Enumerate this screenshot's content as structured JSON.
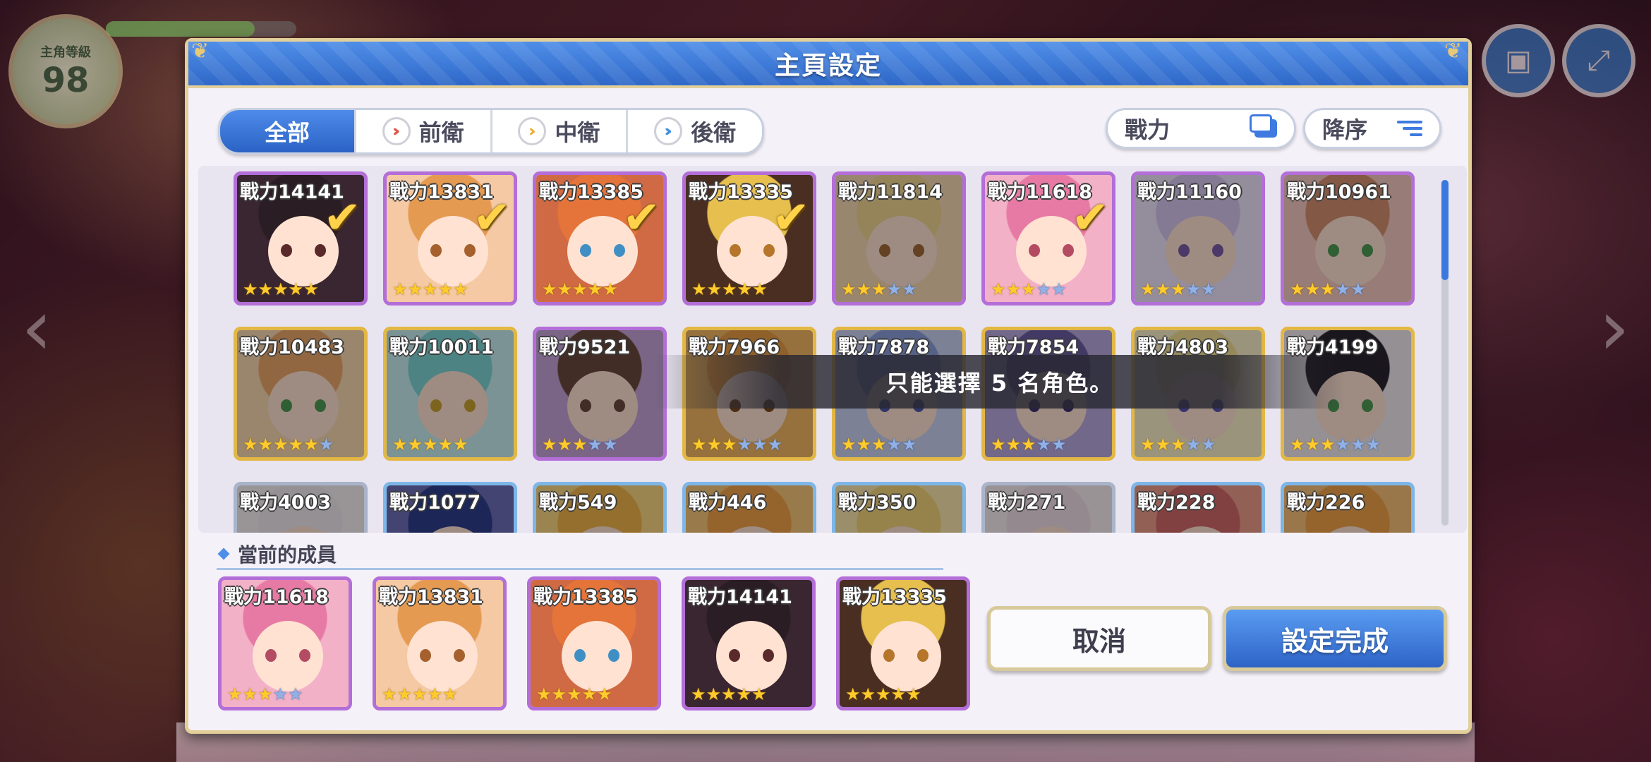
{
  "background": {
    "level_caption": "主角等級",
    "level": "98"
  },
  "dialog": {
    "title": "主頁設定",
    "tabs": [
      {
        "label": "全部",
        "active": true
      },
      {
        "label": "前衛",
        "icon": "vanguard-icon",
        "color": "#e05a4e"
      },
      {
        "label": "中衛",
        "icon": "midguard-icon",
        "color": "#f0a82a"
      },
      {
        "label": "後衛",
        "icon": "rearguard-icon",
        "color": "#3f8fe0"
      }
    ],
    "sort_key": "戰力",
    "sort_order": "降序",
    "characters": [
      {
        "power": "戰力14141",
        "stars": 5,
        "max_stars": 5,
        "selected": true,
        "frame": "purple",
        "hair": "#2b1d24",
        "bg": "#3a2630",
        "eye": "#5a2a2a"
      },
      {
        "power": "戰力13831",
        "stars": 5,
        "max_stars": 5,
        "selected": true,
        "frame": "purple",
        "hair": "#e59a52",
        "bg": "#f4c9a3",
        "eye": "#a5602d"
      },
      {
        "power": "戰力13385",
        "stars": 5,
        "max_stars": 5,
        "selected": true,
        "frame": "purple",
        "hair": "#e4743a",
        "bg": "#d06a44",
        "eye": "#3f8fc4"
      },
      {
        "power": "戰力13335",
        "stars": 5,
        "max_stars": 5,
        "selected": true,
        "frame": "purple",
        "hair": "#e6bf4f",
        "bg": "#4a2e22",
        "eye": "#b5752a"
      },
      {
        "power": "戰力11814",
        "stars": 3,
        "max_stars": 5,
        "selected": false,
        "frame": "purple",
        "hair": "#f1d390",
        "bg": "#f7d9b4",
        "eye": "#a06a38"
      },
      {
        "power": "戰力11618",
        "stars": 3,
        "max_stars": 5,
        "selected": true,
        "frame": "purple",
        "hair": "#e77aa4",
        "bg": "#f3b1c8",
        "eye": "#b34c62"
      },
      {
        "power": "戰力11160",
        "stars": 3,
        "max_stars": 5,
        "selected": false,
        "frame": "purple",
        "hair": "#d6c6ef",
        "bg": "#efe4fb",
        "eye": "#7b5da6"
      },
      {
        "power": "戰力10961",
        "stars": 3,
        "max_stars": 5,
        "selected": false,
        "frame": "purple",
        "hair": "#d48e6e",
        "bg": "#f6c8c0",
        "eye": "#4f9a55"
      },
      {
        "power": "戰力10483",
        "stars": 5,
        "max_stars": 6,
        "selected": false,
        "frame": "gold",
        "hair": "#eba76b",
        "bg": "#f9d9b0",
        "eye": "#4f9a55"
      },
      {
        "power": "戰力10011",
        "stars": 5,
        "max_stars": 5,
        "selected": false,
        "frame": "gold",
        "hair": "#7ed3d6",
        "bg": "#c7eef0",
        "eye": "#c9a233"
      },
      {
        "power": "戰力9521",
        "stars": 3,
        "max_stars": 5,
        "selected": false,
        "frame": "purple",
        "hair": "#6a4a3c",
        "bg": "#c5a3d9",
        "eye": "#6a4a3c"
      },
      {
        "power": "戰力7966",
        "stars": 3,
        "max_stars": 6,
        "selected": false,
        "frame": "gold",
        "hair": "#e89b45",
        "bg": "#f2b763",
        "eye": "#7a4a20"
      },
      {
        "power": "戰力7878",
        "stars": 3,
        "max_stars": 5,
        "selected": false,
        "frame": "gold",
        "hair": "#8b9ddc",
        "bg": "#c8d0f0",
        "eye": "#4c5aa8"
      },
      {
        "power": "戰力7854",
        "stars": 3,
        "max_stars": 5,
        "selected": false,
        "frame": "gold",
        "hair": "#6c5ca3",
        "bg": "#b8a8de",
        "eye": "#3f3170"
      },
      {
        "power": "戰力4803",
        "stars": 3,
        "max_stars": 5,
        "selected": false,
        "frame": "gold",
        "hair": "#f1dd95",
        "bg": "#fbefc9",
        "eye": "#5a53b0"
      },
      {
        "power": "戰力4199",
        "stars": 3,
        "max_stars": 6,
        "selected": false,
        "frame": "gold",
        "hair": "#2a2430",
        "bg": "#efe9ef",
        "eye": "#4f9a55"
      },
      {
        "power": "戰力4003",
        "stars": 0,
        "max_stars": 0,
        "selected": false,
        "frame": "silver",
        "hair": "#f1e8ef",
        "bg": "#f7f0f4",
        "eye": "#b05a7a"
      },
      {
        "power": "戰力1077",
        "stars": 0,
        "max_stars": 0,
        "selected": false,
        "frame": "blue",
        "hair": "#2e3f8e",
        "bg": "#6f6fb8",
        "eye": "#2e3f8e"
      },
      {
        "power": "戰力549",
        "stars": 0,
        "max_stars": 0,
        "selected": false,
        "frame": "blue",
        "hair": "#f1b34a",
        "bg": "#f8d682",
        "eye": "#a06a38"
      },
      {
        "power": "戰力446",
        "stars": 0,
        "max_stars": 0,
        "selected": false,
        "frame": "blue",
        "hair": "#f1a24a",
        "bg": "#f7c77a",
        "eye": "#a06a38"
      },
      {
        "power": "戰力350",
        "stars": 0,
        "max_stars": 0,
        "selected": false,
        "frame": "blue",
        "hair": "#f3d27a",
        "bg": "#fae6ac",
        "eye": "#a06a38"
      },
      {
        "power": "戰力271",
        "stars": 0,
        "max_stars": 0,
        "selected": false,
        "frame": "silver",
        "hair": "#f1dde8",
        "bg": "#f8edf3",
        "eye": "#b05a7a"
      },
      {
        "power": "戰力228",
        "stars": 0,
        "max_stars": 0,
        "selected": false,
        "frame": "blue",
        "hair": "#d26a6a",
        "bg": "#ee9c8c",
        "eye": "#8a3a3a"
      },
      {
        "power": "戰力226",
        "stars": 0,
        "max_stars": 0,
        "selected": false,
        "frame": "blue",
        "hair": "#f0a24a",
        "bg": "#f7c17a",
        "eye": "#8a5a2a"
      }
    ],
    "toast": "只能選擇 5 名角色。",
    "members_title": "當前的成員",
    "members": [
      {
        "power": "戰力11618",
        "stars": 3,
        "max_stars": 5,
        "hair": "#e77aa4",
        "bg": "#f3b1c8",
        "eye": "#b34c62"
      },
      {
        "power": "戰力13831",
        "stars": 5,
        "max_stars": 5,
        "hair": "#e59a52",
        "bg": "#f4c9a3",
        "eye": "#a5602d"
      },
      {
        "power": "戰力13385",
        "stars": 5,
        "max_stars": 5,
        "hair": "#e4743a",
        "bg": "#d06a44",
        "eye": "#3f8fc4"
      },
      {
        "power": "戰力14141",
        "stars": 5,
        "max_stars": 5,
        "hair": "#2b1d24",
        "bg": "#3a2630",
        "eye": "#5a2a2a"
      },
      {
        "power": "戰力13335",
        "stars": 5,
        "max_stars": 5,
        "hair": "#e6bf4f",
        "bg": "#4a2e22",
        "eye": "#b5752a"
      }
    ],
    "cancel_label": "取消",
    "confirm_label": "設定完成"
  }
}
